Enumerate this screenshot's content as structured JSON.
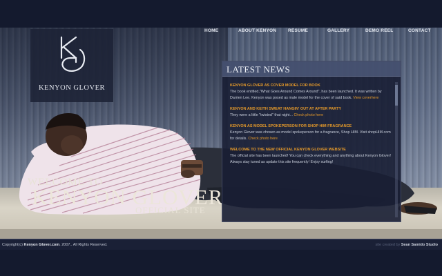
{
  "nav": {
    "items": [
      {
        "label": "HOME"
      },
      {
        "label": "ABOUT KENYON"
      },
      {
        "label": "RESUME"
      },
      {
        "label": "GALLERY"
      },
      {
        "label": "DEMO REEL"
      },
      {
        "label": "CONTACT"
      }
    ]
  },
  "logo": {
    "monogram": "KG",
    "name": "KENYON GLOVER"
  },
  "welcome": {
    "line1": "WELCOME TO",
    "line2": "KENYON GLOVER",
    "line3": "OFFICIAL SITE"
  },
  "news": {
    "title": "LATEST NEWS",
    "items": [
      {
        "title": "KENYON GLOVER AS COVER MODEL FOR BOOK",
        "text": "The book entitled,\"What Goes Around Comes Around\", has been launched. It was written by Darrien Lee. Kenyon was posed as male model for the cover of said book.",
        "link": "View coverhere"
      },
      {
        "title": "KENYON AND KEITH SWEAT HANGIN' OUT AT AFTER PARTY",
        "text": "They were a little \"twisted\" that night...",
        "link": "Check photo here"
      },
      {
        "title": "KENYON AS MODEL SPOKEPERSON FOR SHOP HIM FRAGRANCE",
        "text": "Kenyon Glover was chosen as model spokeperson for a fragrance, Shop HIM. Visit shopHIM.com for details.",
        "link": "Check photo here"
      },
      {
        "title": "WELCOME TO THE NEW OFFICIAL KENYON GLOVER WEBSITE",
        "text": "The official site has been launched! You can check everything and anything about Kenyon Glover! Always stay tuned as update this site frequently! Enjoy surfing!",
        "link": ""
      }
    ]
  },
  "footer": {
    "copyright_prefix": "Copyright(c)",
    "copyright_site": "Kenyon Glover.com",
    "copyright_suffix": ". 2007.. All Rights Reserved.",
    "credit_prefix": "site created by",
    "credit_name": "Sean Samido Studio"
  },
  "colors": {
    "background": "#141a2e",
    "accent": "#e79b2a",
    "panel": "#181e34"
  }
}
